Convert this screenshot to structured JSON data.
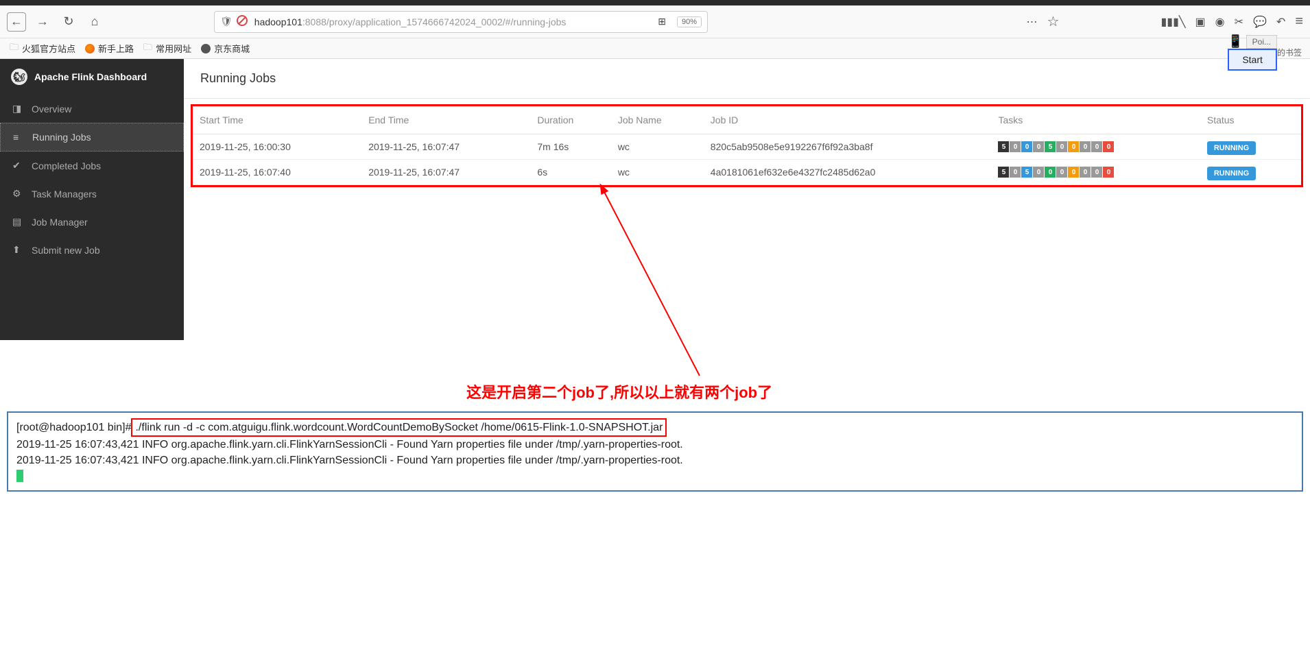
{
  "url": {
    "prefix": "hadoop101",
    "rest": ":8088/proxy/application_1574666742024_0002/#/running-jobs",
    "zoom": "90%"
  },
  "popup": {
    "top": "Poi...",
    "start": "Start",
    "right_text": "上的书签"
  },
  "bookmarks": {
    "b1": "火狐官方站点",
    "b2": "新手上路",
    "b3": "常用网址",
    "b4": "京东商城"
  },
  "sidebar": {
    "title": "Apache Flink Dashboard",
    "items": {
      "overview": "Overview",
      "running": "Running Jobs",
      "completed": "Completed Jobs",
      "tm": "Task Managers",
      "jm": "Job Manager",
      "submit": "Submit new Job"
    }
  },
  "page_title": "Running Jobs",
  "table": {
    "headers": {
      "start": "Start Time",
      "end": "End Time",
      "duration": "Duration",
      "jobname": "Job Name",
      "jobid": "Job ID",
      "tasks": "Tasks",
      "status": "Status"
    },
    "rows": [
      {
        "start": "2019-11-25, 16:00:30",
        "end": "2019-11-25, 16:07:47",
        "duration": "7m 16s",
        "jobname": "wc",
        "jobid": "820c5ab9508e5e9192267f6f92a3ba8f",
        "tasks": [
          "5",
          "0",
          "0",
          "0",
          "5",
          "0",
          "0",
          "0",
          "0",
          "0"
        ],
        "status": "RUNNING"
      },
      {
        "start": "2019-11-25, 16:07:40",
        "end": "2019-11-25, 16:07:47",
        "duration": "6s",
        "jobname": "wc",
        "jobid": "4a0181061ef632e6e4327fc2485d62a0",
        "tasks": [
          "5",
          "0",
          "5",
          "0",
          "0",
          "0",
          "0",
          "0",
          "0",
          "0"
        ],
        "status": "RUNNING"
      }
    ]
  },
  "annotation": "这是开启第二个job了,所以以上就有两个job了",
  "terminal": {
    "prompt": "[root@hadoop101 bin]#",
    "command": " ./flink run -d -c com.atguigu.flink.wordcount.WordCountDemoBySocket /home/0615-Flink-1.0-SNAPSHOT.jar ",
    "line1": "2019-11-25 16:07:43,421 INFO  org.apache.flink.yarn.cli.FlinkYarnSessionCli                 - Found Yarn properties file under /tmp/.yarn-properties-root.",
    "line2": "2019-11-25 16:07:43,421 INFO  org.apache.flink.yarn.cli.FlinkYarnSessionCli                 - Found Yarn properties file under /tmp/.yarn-properties-root."
  }
}
